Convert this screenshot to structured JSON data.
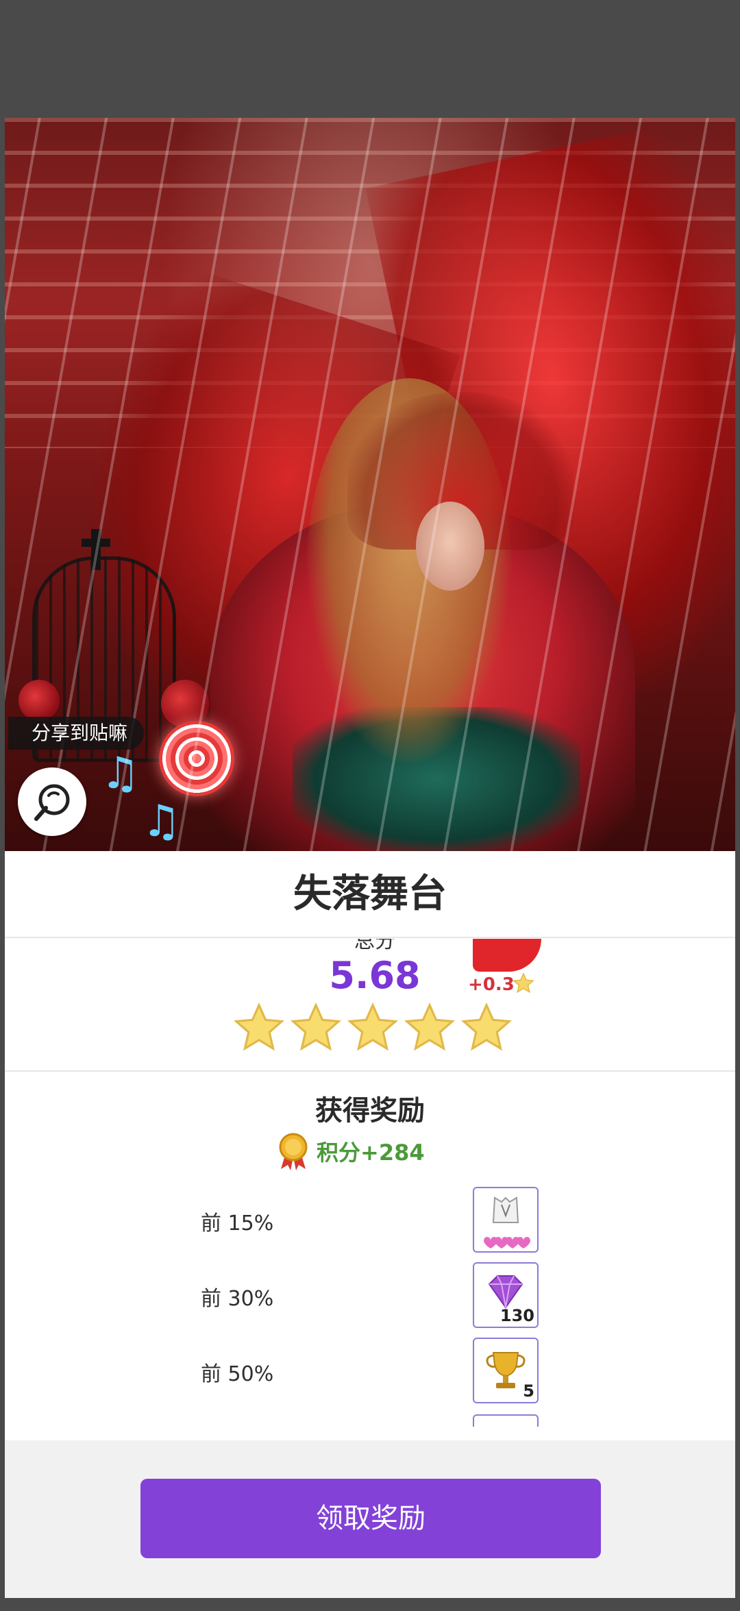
{
  "share": {
    "label": "分享到贴嘛"
  },
  "result": {
    "title": "失落舞台",
    "score_label": "总分",
    "score_value": "5.68",
    "bonus": "+0.3",
    "stars": 5
  },
  "rewards": {
    "title": "获得奖励",
    "points": "积分+284",
    "tiers": [
      {
        "label": "前 15%",
        "icon": "outfit-piece-icon",
        "count": ""
      },
      {
        "label": "前 30%",
        "icon": "diamond-icon",
        "count": "130"
      },
      {
        "label": "前 50%",
        "icon": "trophy-icon",
        "count": "5"
      }
    ]
  },
  "footer": {
    "claim_button": "领取奖励"
  },
  "colors": {
    "accent": "#8341d8",
    "score": "#7a36d6",
    "points": "#4b9a3a",
    "bonus": "#d4323a"
  }
}
